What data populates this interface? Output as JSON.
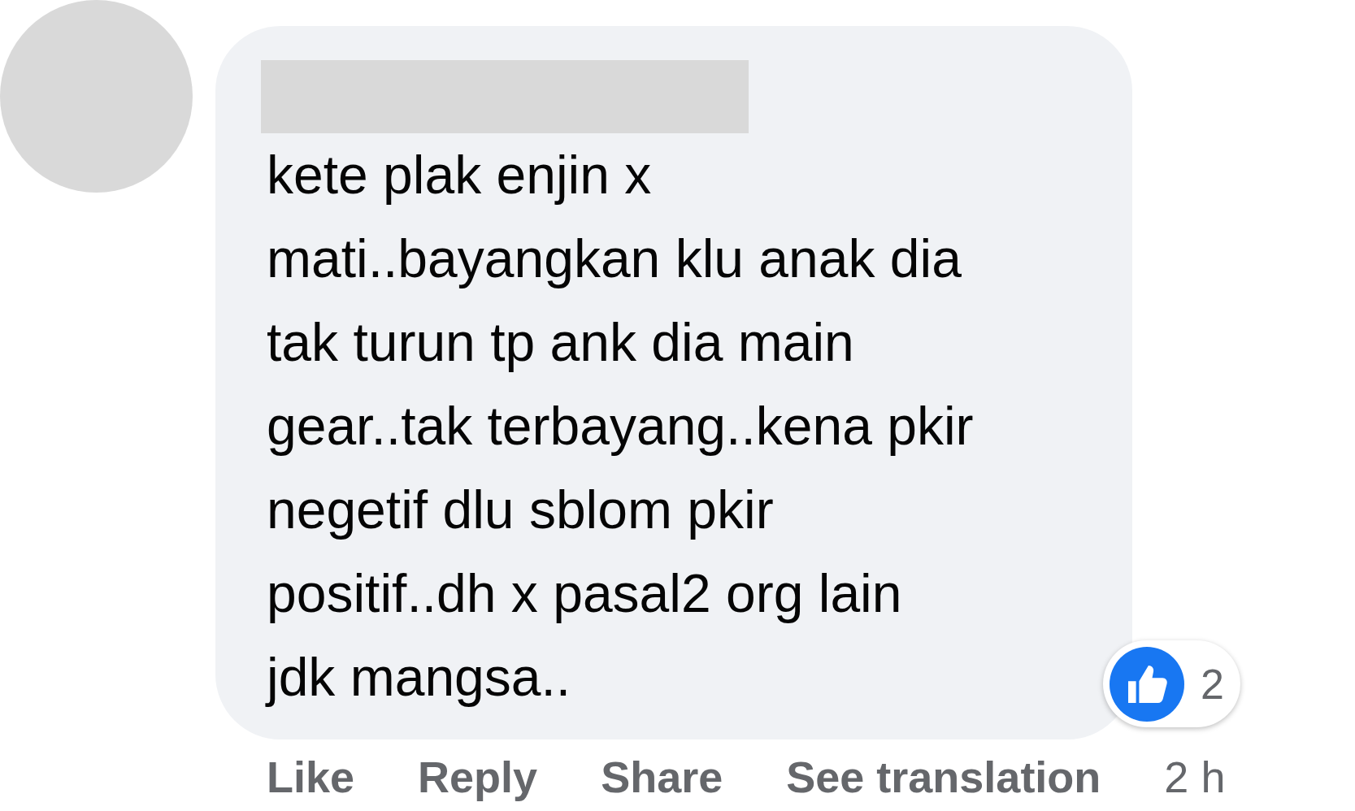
{
  "comment": {
    "lines": [
      "kete plak enjin x",
      "mati..bayangkan klu anak dia",
      "tak turun tp ank dia main",
      "gear..tak terbayang..kena pkir",
      "negetif dlu sblom pkir",
      "positif..dh x pasal2 org lain",
      "jdk mangsa.."
    ],
    "reaction_count": "2"
  },
  "actions": [
    {
      "label": "Like",
      "kind": "link"
    },
    {
      "label": "Reply",
      "kind": "link"
    },
    {
      "label": "Share",
      "kind": "link"
    },
    {
      "label": "See translation",
      "kind": "link"
    },
    {
      "label": "2 h",
      "kind": "time"
    }
  ]
}
